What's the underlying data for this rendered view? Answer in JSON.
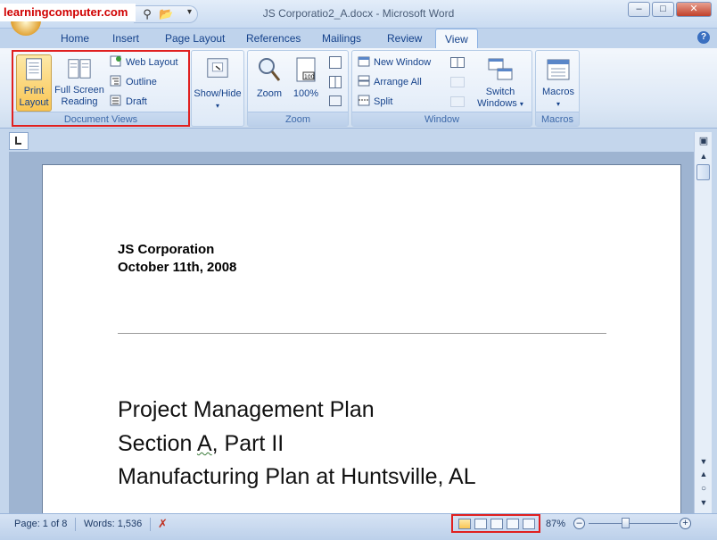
{
  "watermark": "learningcomputer.com",
  "window": {
    "title": "JS Corporatio2_A.docx - Microsoft Word"
  },
  "tabs": [
    "Home",
    "Insert",
    "Page Layout",
    "References",
    "Mailings",
    "Review",
    "View"
  ],
  "active_tab": "View",
  "ribbon": {
    "document_views": {
      "label": "Document Views",
      "print_layout": [
        "Print",
        "Layout"
      ],
      "full_screen_reading": [
        "Full Screen",
        "Reading"
      ],
      "web_layout": "Web Layout",
      "outline": "Outline",
      "draft": "Draft"
    },
    "show_hide": {
      "label": "Show/Hide"
    },
    "zoom": {
      "label": "Zoom",
      "zoom_button": "Zoom",
      "percent_button": "100%"
    },
    "window": {
      "label": "Window",
      "new_window": "New Window",
      "arrange_all": "Arrange All",
      "split": "Split",
      "switch_windows": [
        "Switch",
        "Windows"
      ]
    },
    "macros": {
      "label": "Macros",
      "button": "Macros"
    }
  },
  "document": {
    "header_line1": "JS Corporation",
    "header_line2": "October 11th, 2008",
    "title_line1": "Project Management Plan",
    "title_line2_pre": "Section ",
    "title_line2_word": "A",
    "title_line2_post": ", Part II",
    "title_line3": "Manufacturing Plan at Huntsville, AL"
  },
  "status": {
    "page": "Page: 1 of 8",
    "words": "Words: 1,536",
    "zoom": "87%"
  },
  "colors": {
    "highlight_box": "#e02020",
    "active_button": "#f9c553"
  }
}
